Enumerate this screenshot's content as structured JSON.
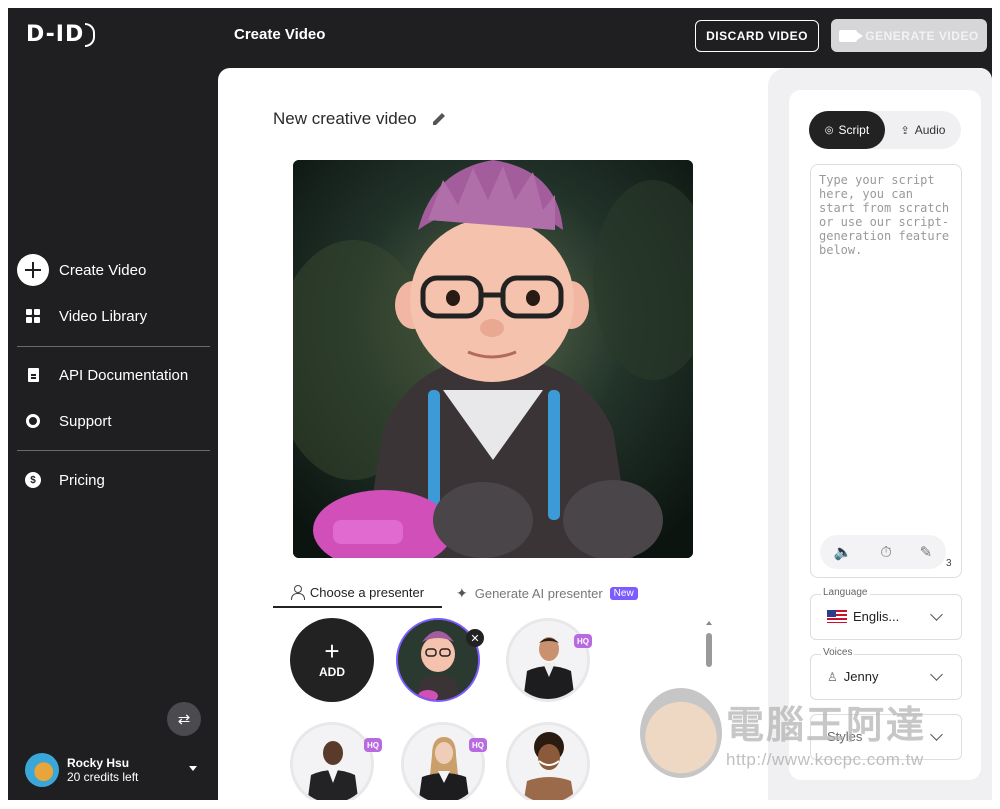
{
  "app": {
    "logo": "D-ID",
    "page_title": "Create Video"
  },
  "top_buttons": {
    "discard": "DISCARD VIDEO",
    "generate": "GENERATE VIDEO"
  },
  "sidebar": {
    "items": [
      {
        "label": "Create Video",
        "icon": "plus-circle-icon"
      },
      {
        "label": "Video Library",
        "icon": "grid-icon"
      },
      {
        "label": "API Documentation",
        "icon": "document-icon"
      },
      {
        "label": "Support",
        "icon": "lifebuoy-icon"
      },
      {
        "label": "Pricing",
        "icon": "dollar-icon"
      }
    ],
    "user": {
      "name": "Rocky Hsu",
      "credits": "20 credits left"
    }
  },
  "editor": {
    "video_title": "New creative video",
    "tabs": {
      "choose": "Choose a presenter",
      "generate": "Generate AI presenter",
      "new_badge": "New"
    },
    "add_label": "ADD",
    "hq_badge": "HQ",
    "remove_symbol": "✕"
  },
  "script_panel": {
    "tab_script": "Script",
    "tab_audio": "Audio",
    "placeholder": "Type your script here, you can start from scratch or use our script-generation feature below.",
    "char_count": "3",
    "language_label": "Language",
    "language_value": "Englis...",
    "voices_label": "Voices",
    "voices_value": "Jenny",
    "styles_label": "Styles"
  },
  "watermark": {
    "text": "電腦王阿達",
    "url": "http://www.kocpc.com.tw"
  }
}
